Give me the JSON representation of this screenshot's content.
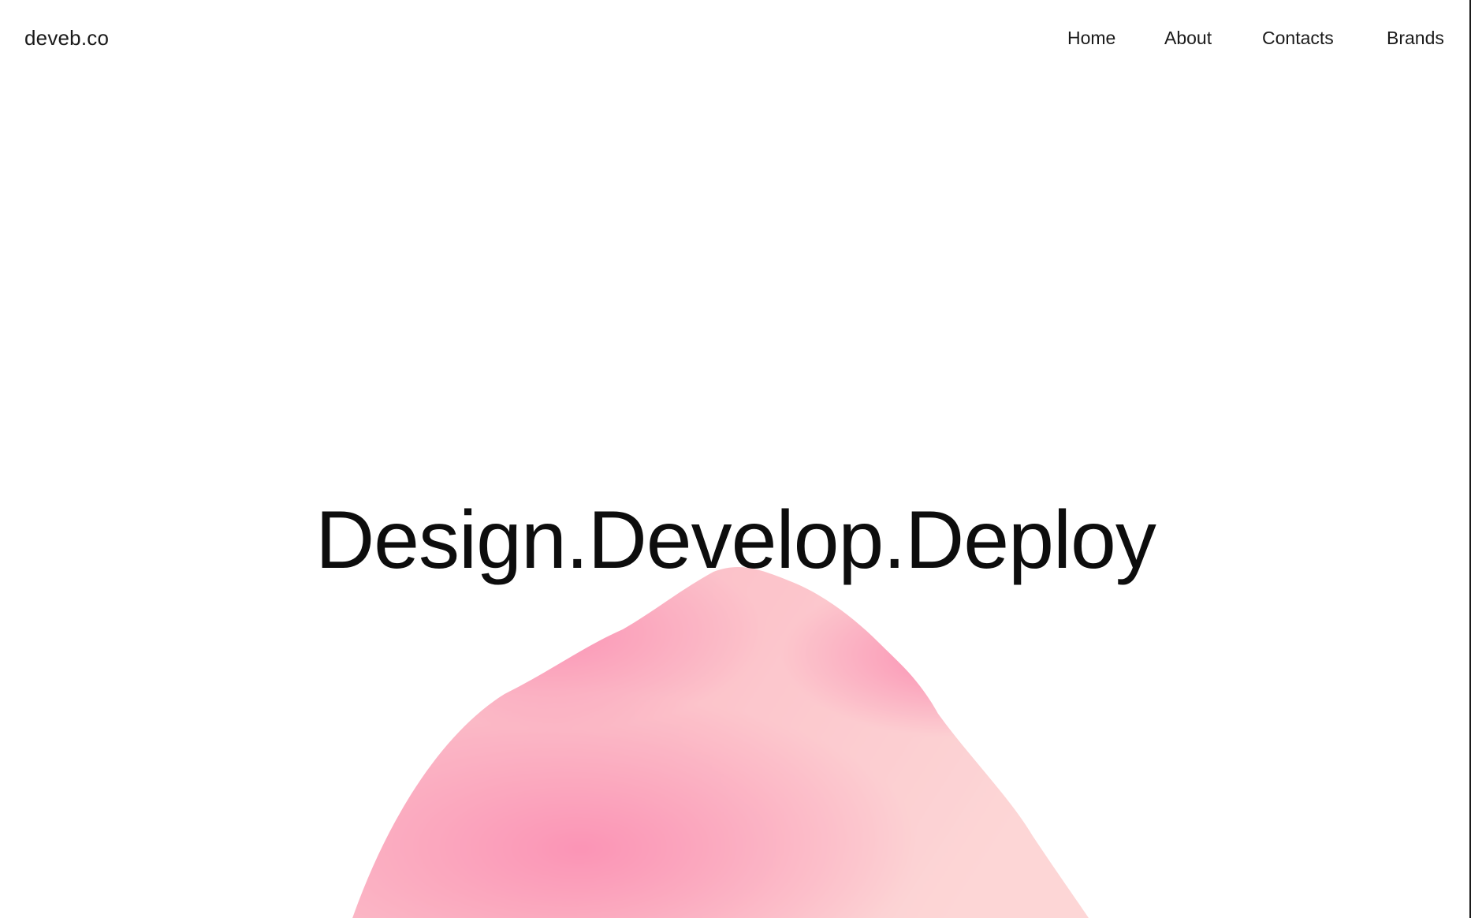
{
  "nav": {
    "brand": "deveb.co",
    "links": [
      {
        "label": "Home"
      },
      {
        "label": "About"
      },
      {
        "label": "Contacts"
      },
      {
        "label": "Brands"
      }
    ]
  },
  "hero": {
    "headline": "Design.Develop.Deploy"
  },
  "colors": {
    "background": "#ffffff",
    "text": "#111111",
    "blob_light": "#fcd3d3",
    "blob_deep": "#fb93b5"
  }
}
